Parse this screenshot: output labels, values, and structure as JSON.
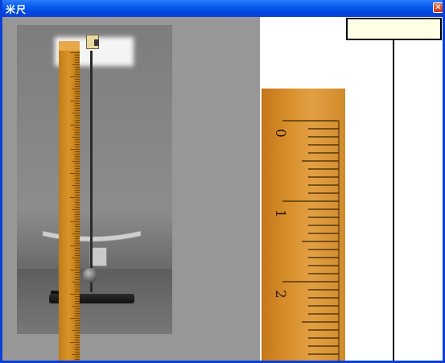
{
  "window": {
    "title": "米尺",
    "close_glyph": "✕"
  },
  "reading": {
    "value": ""
  },
  "zoom_ruler": {
    "labels": [
      "0",
      "1",
      "2"
    ]
  },
  "colors": {
    "titlebar": "#0a5ef0",
    "ruler": "#d9912d",
    "reading_bg": "#ffffe6"
  }
}
